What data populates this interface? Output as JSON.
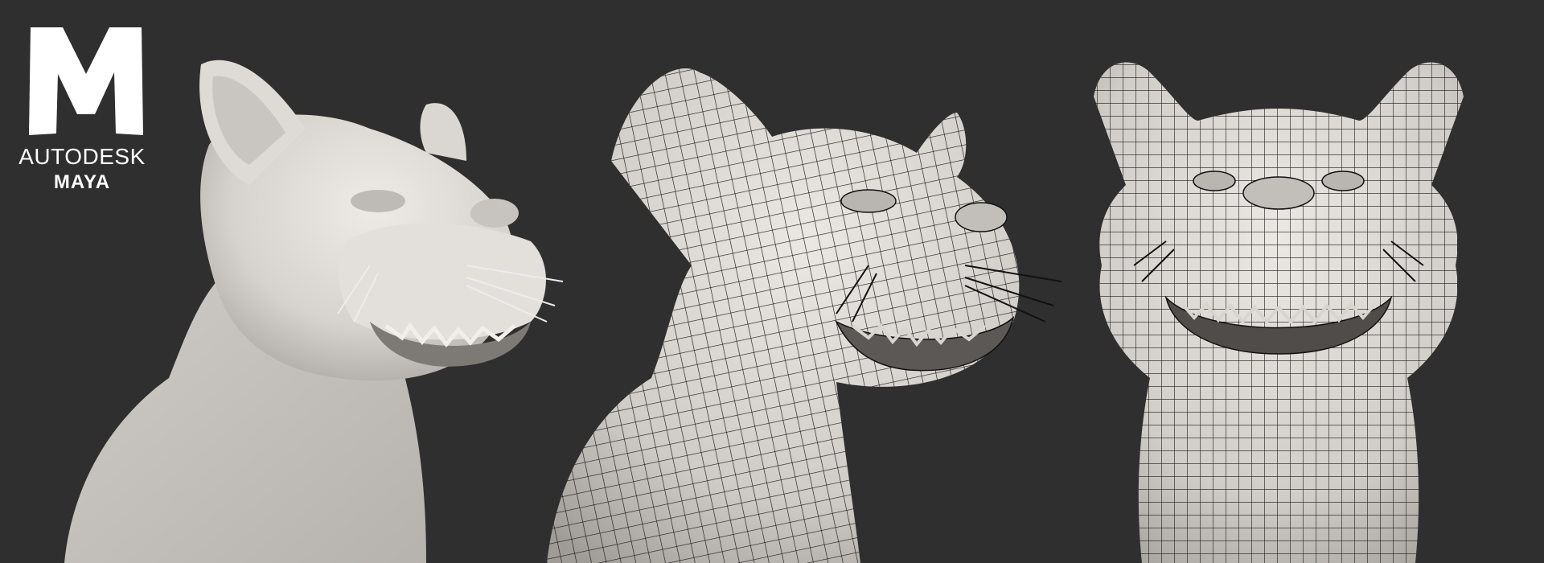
{
  "logo": {
    "brand": "AUTODESK",
    "product": "MAYA",
    "glyph": "M"
  },
  "renders": [
    {
      "name": "smooth-shaded-dog-render",
      "shading": "smooth"
    },
    {
      "name": "wireframe-side-dog-render",
      "shading": "wireframe-on-shaded"
    },
    {
      "name": "wireframe-front-dog-render",
      "shading": "wireframe-on-shaded"
    }
  ],
  "colors": {
    "background": "#2f2f2f",
    "clay": "#d9d6d1",
    "clay_shadow": "#a9a6a1",
    "wire": "#1a1a1a",
    "logo": "#ffffff"
  }
}
